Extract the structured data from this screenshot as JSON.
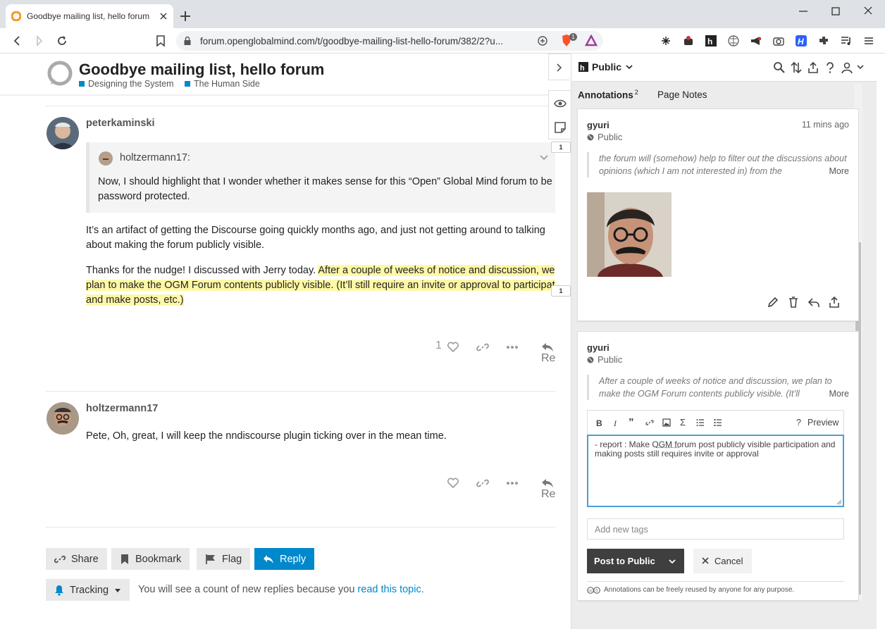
{
  "browser": {
    "tab_title": "Goodbye mailing list, hello forum",
    "url": "forum.openglobalmind.com/t/goodbye-mailing-list-hello-forum/382/2?u...",
    "brave_badge": "1"
  },
  "topic": {
    "title": "Goodbye mailing list, hello forum",
    "categories": [
      {
        "label": "Designing the System",
        "color": "#0088cc"
      },
      {
        "label": "The Human Side",
        "color": "#0088cc"
      }
    ]
  },
  "posts": [
    {
      "username": "peterkaminski",
      "quote_author": "holtzermann17:",
      "quote_text": "Now, I should highlight that I wonder whether it makes sense for this “Open” Global Mind forum to be password protected.",
      "para1": "It’s an artifact of getting the Discourse going quickly months ago, and just not getting around to talking about making the forum publicly visible.",
      "para2_plain": "Thanks for the nudge! I discussed with Jerry today. ",
      "para2_highlight": "After a couple of weeks of notice and discussion, we plan to make the OGM Forum contents publicly visible. (It’ll still require an invite or approval to participate and make posts, etc.)",
      "likes": "1",
      "reply_label": "Reply"
    },
    {
      "username": "holtzermann17",
      "text": "Pete, Oh, great, I will keep the nndiscourse plugin ticking over in the mean time.",
      "reply_label": "Reply"
    }
  ],
  "footer_buttons": {
    "share": "Share",
    "bookmark": "Bookmark",
    "flag": "Flag",
    "reply": "Reply",
    "tracking": "Tracking"
  },
  "tracking_text": "You will see a count of new replies because you ",
  "tracking_link": "read this topic.",
  "sidebar": {
    "group": "Public",
    "tab_annotations": "Annotations",
    "annotations_count": "2",
    "tab_page_notes": "Page Notes",
    "bucket_counts": [
      "1",
      "1"
    ],
    "annotation1": {
      "user": "gyuri",
      "time": "11 mins ago",
      "visibility": "Public",
      "quote": "the forum will (somehow) help to filter out the discussions about opinions (which I am not interested in) from the",
      "more": "More"
    },
    "annotation2": {
      "user": "gyuri",
      "visibility": "Public",
      "quote": "After a couple of weeks of notice and discussion, we plan to make the OGM Forum contents publicly visible. (It’ll",
      "more": "More",
      "preview_label": "Preview",
      "textarea_value": "- report : Make OGM forum post publicly visible participation and making posts still requires invite or approval",
      "tags_placeholder": "Add new tags",
      "post_label": "Post to Public",
      "cancel_label": "Cancel",
      "license": "Annotations can be freely reused by anyone for any purpose."
    }
  }
}
